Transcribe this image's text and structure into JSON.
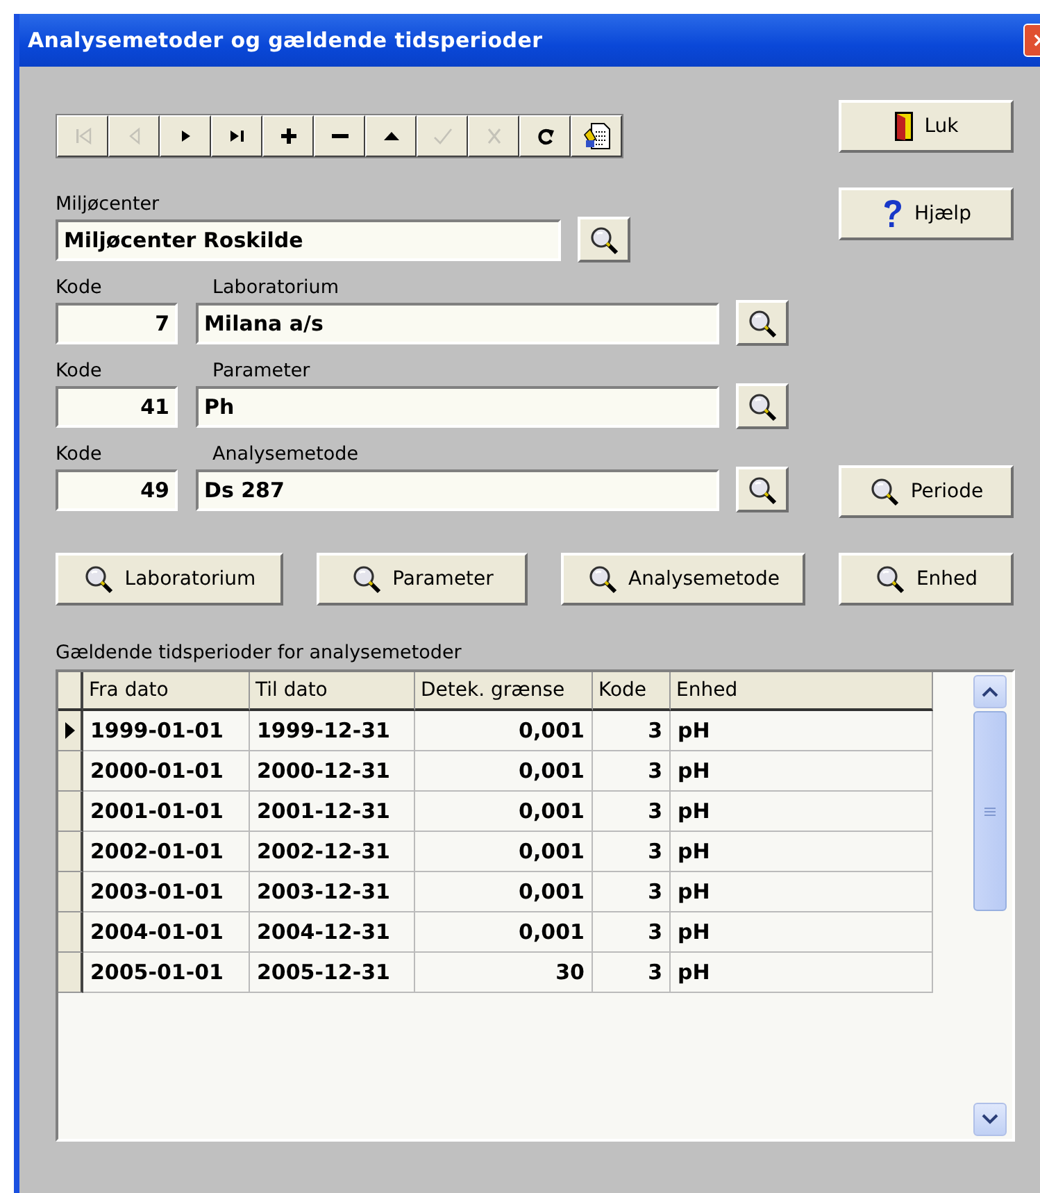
{
  "window": {
    "title": "Analysemetoder og gældende tidsperioder"
  },
  "toolbar": [
    {
      "kind": "first",
      "disabled": true
    },
    {
      "kind": "prev",
      "disabled": true
    },
    {
      "kind": "next",
      "disabled": false
    },
    {
      "kind": "last",
      "disabled": false
    },
    {
      "kind": "add",
      "disabled": false
    },
    {
      "kind": "delete",
      "disabled": false
    },
    {
      "kind": "up",
      "disabled": false
    },
    {
      "kind": "confirm",
      "disabled": true
    },
    {
      "kind": "cancel",
      "disabled": true
    },
    {
      "kind": "refresh",
      "disabled": false
    },
    {
      "kind": "report",
      "disabled": false
    }
  ],
  "side_buttons": [
    {
      "kind": "close",
      "label": "Luk"
    },
    {
      "kind": "help",
      "label": "Hjælp"
    }
  ],
  "center": {
    "label": "Miljøcenter",
    "value": "Miljøcenter Roskilde"
  },
  "lookups": [
    {
      "code_label": "Kode",
      "code": "7",
      "name_label": "Laboratorium",
      "name": "Milana a/s"
    },
    {
      "code_label": "Kode",
      "code": "41",
      "name_label": "Parameter",
      "name": "Ph"
    },
    {
      "code_label": "Kode",
      "code": "49",
      "name_label": "Analysemetode",
      "name": "Ds 287"
    }
  ],
  "period_button": "Periode",
  "search_buttons": [
    "Laboratorium",
    "Parameter",
    "Analysemetode",
    "Enhed"
  ],
  "table": {
    "caption": "Gældende tidsperioder for analysemetoder",
    "columns": [
      "Fra dato",
      "Til dato",
      "Detek. grænse",
      "Kode",
      "Enhed"
    ],
    "rows": [
      {
        "selected": true,
        "cells": [
          "1999-01-01",
          "1999-12-31",
          "0,001",
          "3",
          "pH"
        ]
      },
      {
        "selected": false,
        "cells": [
          "2000-01-01",
          "2000-12-31",
          "0,001",
          "3",
          "pH"
        ]
      },
      {
        "selected": false,
        "cells": [
          "2001-01-01",
          "2001-12-31",
          "0,001",
          "3",
          "pH"
        ]
      },
      {
        "selected": false,
        "cells": [
          "2002-01-01",
          "2002-12-31",
          "0,001",
          "3",
          "pH"
        ]
      },
      {
        "selected": false,
        "cells": [
          "2003-01-01",
          "2003-12-31",
          "0,001",
          "3",
          "pH"
        ]
      },
      {
        "selected": false,
        "cells": [
          "2004-01-01",
          "2004-12-31",
          "0,001",
          "3",
          "pH"
        ]
      },
      {
        "selected": false,
        "cells": [
          "2005-01-01",
          "2005-12-31",
          "30",
          "3",
          "pH"
        ]
      }
    ]
  }
}
